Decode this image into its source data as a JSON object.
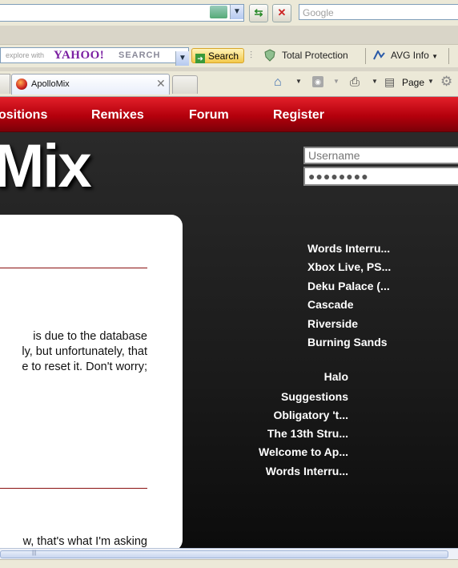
{
  "browser": {
    "search_placeholder": "Google",
    "yahoo_explore": "explore with",
    "yahoo_logo": "YAHOO!",
    "yahoo_search_word": "SEARCH",
    "yahoo_search_button": "Search",
    "total_protection": "Total Protection",
    "avg_info": "AVG Info",
    "tab_title": "ApolloMix",
    "page_menu": "Page"
  },
  "site": {
    "nav": [
      "ositions",
      "Remixes",
      "Forum",
      "Register"
    ],
    "logo_text": "Mix",
    "username_placeholder": "Username",
    "password_mask": "●●●●●●●●",
    "body_lines": [
      "is due to the database",
      "ly, but unfortunately, that",
      "e to reset it. Don't worry;"
    ],
    "bottom_line": "w, that's what I'm asking",
    "sidebar_links_1": [
      "Words Interru...",
      "Xbox Live, PS...",
      "Deku Palace (...",
      "Cascade",
      "Riverside",
      "Burning Sands"
    ],
    "sidebar_links_2": [
      "Halo",
      "Suggestions",
      "Obligatory 't...",
      "The 13th Stru...",
      "Welcome to Ap...",
      "Words Interru..."
    ]
  }
}
